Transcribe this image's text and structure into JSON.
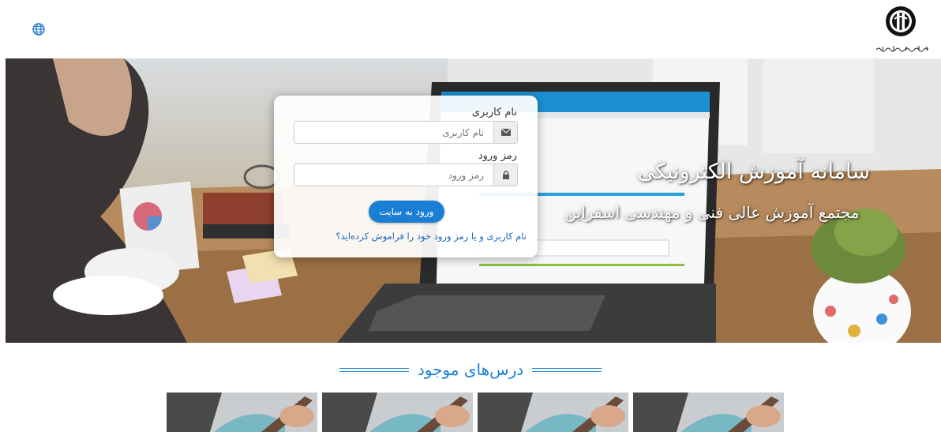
{
  "header": {
    "language_icon": "globe-icon",
    "logo_icon": "institution-emblem-icon"
  },
  "hero": {
    "title": "سامانه آموزش الکترونیکی",
    "subtitle": "مجتمع آموزش عالی فنی و مهندسی اسفراین"
  },
  "login": {
    "username_label": "نام کاربری",
    "username_placeholder": "نام کاربری",
    "username_icon": "envelope-icon",
    "password_label": "رمز ورود",
    "password_placeholder": "رمز ورود",
    "password_icon": "lock-icon",
    "submit_label": "ورود به سایت",
    "forgot_link": "نام کاربری و یا رمز ورود خود را فراموش کرده‌اید؟"
  },
  "courses": {
    "heading": "درس‌های موجود",
    "items": [
      {
        "thumbnail": "course-thumbnail-icon"
      },
      {
        "thumbnail": "course-thumbnail-icon"
      },
      {
        "thumbnail": "course-thumbnail-icon"
      },
      {
        "thumbnail": "course-thumbnail-icon"
      }
    ]
  },
  "colors": {
    "accent": "#1a7fd4",
    "link": "#1a66b8"
  }
}
